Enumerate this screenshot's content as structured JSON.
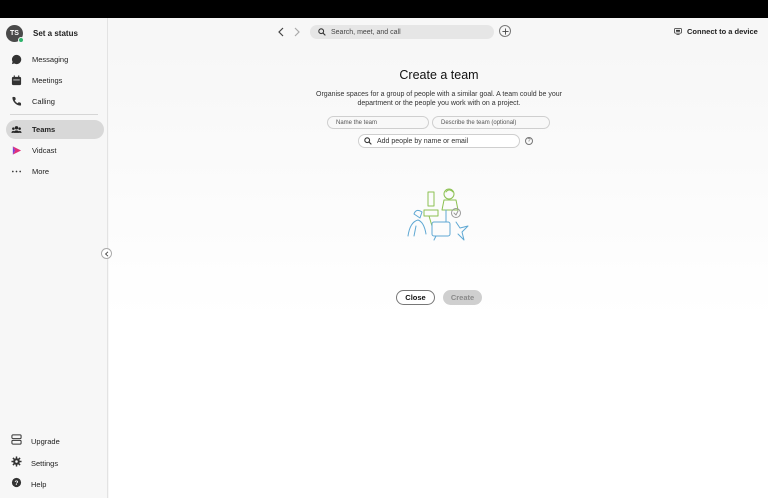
{
  "profile": {
    "initials": "TS",
    "status_label": "Set a status"
  },
  "nav": [
    {
      "label": "Messaging",
      "icon": "chat-bubble-icon"
    },
    {
      "label": "Meetings",
      "icon": "calendar-icon"
    },
    {
      "label": "Calling",
      "icon": "phone-icon"
    },
    {
      "label": "Teams",
      "icon": "people-icon",
      "active": true
    },
    {
      "label": "Vidcast",
      "icon": "vidcast-icon"
    },
    {
      "label": "More",
      "icon": "more-dots-icon"
    }
  ],
  "bottom_nav": [
    {
      "label": "Upgrade",
      "icon": "upgrade-icon"
    },
    {
      "label": "Settings",
      "icon": "gear-icon"
    },
    {
      "label": "Help",
      "icon": "help-icon"
    }
  ],
  "topbar": {
    "search_placeholder": "Search, meet, and call",
    "connect_label": "Connect to a device"
  },
  "dialog": {
    "title": "Create a team",
    "description": "Organise spaces for a group of people with a similar goal. A team could be your department or the people you work with on a project.",
    "name_placeholder": "Name the team",
    "describe_placeholder": "Describe the team (optional)",
    "people_placeholder": "Add people by name or email",
    "help_glyph": "?",
    "close_label": "Close",
    "create_label": "Create"
  },
  "colors": {
    "status_online": "#2fb36b",
    "active_nav": "#d8d8d8",
    "vidcast_accent": "#e0307a"
  }
}
